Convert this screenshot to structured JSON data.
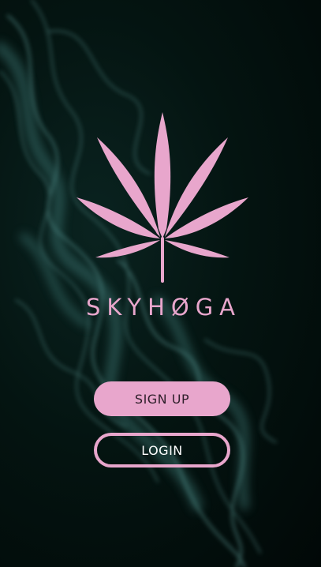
{
  "brand": {
    "name": "SKYHØGA",
    "logo_icon": "cannabis-leaf-icon"
  },
  "actions": {
    "signup_label": "SIGN UP",
    "login_label": "LOGIN"
  },
  "colors": {
    "accent": "#E8A6CC",
    "signup_text": "#2E1F2A",
    "login_text": "#FFFFFF",
    "background": "#03110F",
    "smoke": "#5E9B98"
  }
}
